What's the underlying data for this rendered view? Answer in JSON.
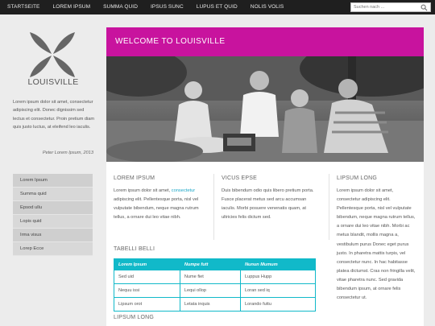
{
  "nav": {
    "items": [
      "STARTSEITE",
      "LOREM IPSUM",
      "SUMMA QUID",
      "IPSUS SUNC",
      "LUPUS ET QUID",
      "NOLIS VOLIS"
    ]
  },
  "search": {
    "placeholder": "Suchen nach ..."
  },
  "sidebar": {
    "brand": "LOUISVILLE",
    "intro": "Lorem ipsum dolor sit amet, consectetur adipiscing elit. Donec dignissim sed lectus et consectetur. Proin pretium diam quis justo luctus, at eleifend leo iaculis.",
    "quote": "Peter Lorem Ipsum, 2013",
    "menu": [
      "Lorem Ipsum",
      "Summa quid",
      "Epsod ullu",
      "Lopis quid",
      "Irma visus",
      "Lorep Ecce"
    ]
  },
  "main": {
    "welcome": "WELCOME TO LOUISVILLE",
    "col1": {
      "title": "LOREM IPSUM",
      "text_a": "Lorem ipsum dolor sit amet, ",
      "link": "consectetur",
      "text_b": " adipiscing elit. Pellentesque porta, nisl vel vulputate bibendum, neque magna rutrum tellus, a ornare dui leo vitae nibh."
    },
    "col2": {
      "title": "VICUS EPSE",
      "text": "Duis bibendum odio quis libero pretium porta. Fusce placerat metus sed arcu accumsan iaculis. Morbi posuere venenatis quam, at ultricies felis dictum sed."
    },
    "col3": {
      "title": "LIPSUM LONG",
      "text": "Lorem ipsum dolor sit amet, consectetur adipiscing elit. Pellentesque porta, nisl vel vulputate bibendum, neque magna rutrum tellus, a ornare dui leo vitae nibh. Morbi ac metus blandit, mollis magna a, vestibulum purus Donec eget purus justo. In pharetra mattis turpis, vel consectetur nunc. In hac habitasse platea dictumst. Cras non fringilla velit, vitae pharetra nunc. Sed gravida bibendum ipsum, at ornare felis consectetur ut."
    },
    "table": {
      "title": "TABELLI BELLI",
      "headers": [
        "Lorem Ipsum",
        "Numpe futt",
        "Nunun Mumum"
      ],
      "rows": [
        [
          "Sed uid",
          "Nume fiet",
          "Luppus Hupp"
        ],
        [
          "Nequu issi",
          "Lequi ollop",
          "Loran sed iq"
        ],
        [
          "Lipsum orot",
          "Letata inquis",
          "Lorando futtu"
        ]
      ]
    },
    "bottom_title": "LIPSUM LONG"
  },
  "colors": {
    "accent": "#c8139e",
    "table": "#11b9c9",
    "link": "#1aa6c7",
    "topbar": "#1f1f1f"
  }
}
